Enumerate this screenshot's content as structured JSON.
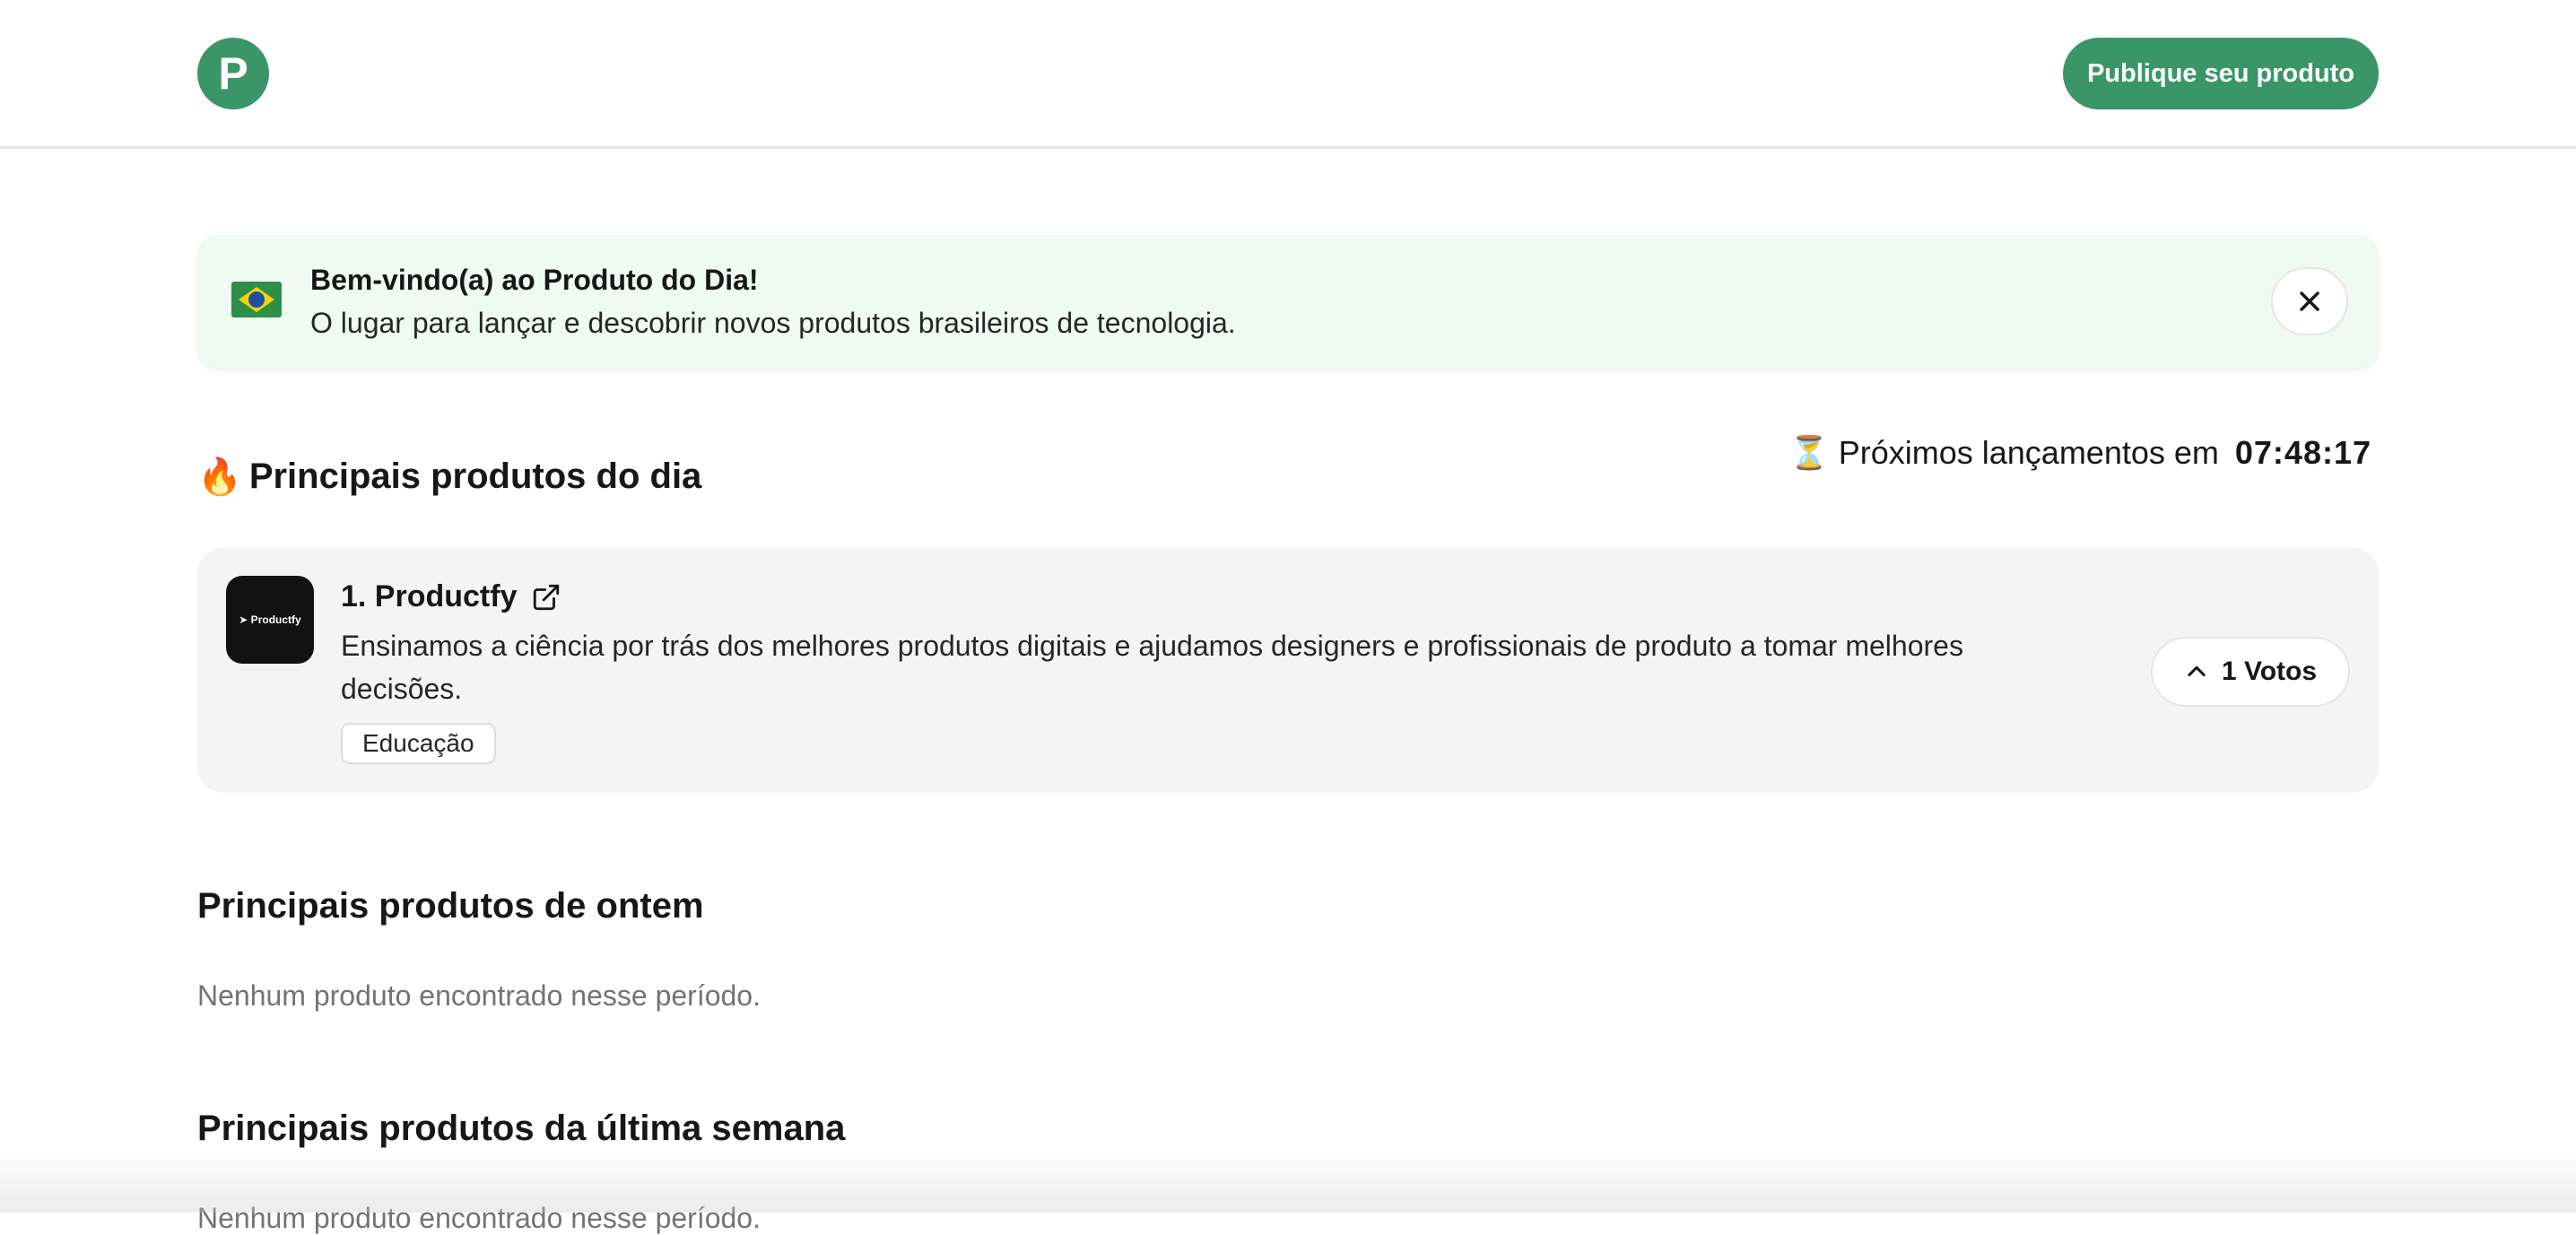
{
  "header": {
    "logo_letter": "P",
    "publish_label": "Publique seu produto"
  },
  "banner": {
    "flag_icon": "brazil-flag-icon",
    "title": "Bem-vindo(a) ao Produto do Dia!",
    "text": "O lugar para lançar e descobrir novos produtos brasileiros de tecnologia.",
    "close_icon": "close-icon"
  },
  "today": {
    "emoji": "🔥",
    "heading": "Principais produtos do dia",
    "countdown_emoji": "⏳",
    "countdown_label": "Próximos lançamentos em",
    "countdown_time": "07:48:17"
  },
  "products": [
    {
      "thumb_text": "➤ Productfy",
      "title": "1. Productfy",
      "description": "Ensinamos a ciência por trás dos melhores produtos digitais e ajudamos designers e profissionais de produto a tomar melhores decisões.",
      "tag": "Educação",
      "votes_label": "1 Votos"
    }
  ],
  "yesterday": {
    "heading": "Principais produtos de ontem",
    "empty": "Nenhum produto encontrado nesse período."
  },
  "last_week": {
    "heading": "Principais produtos da última semana",
    "empty": "Nenhum produto encontrado nesse período."
  },
  "colors": {
    "brand": "#3a9668",
    "banner_bg": "#eefbf3",
    "card_bg": "#f4f4f4"
  }
}
